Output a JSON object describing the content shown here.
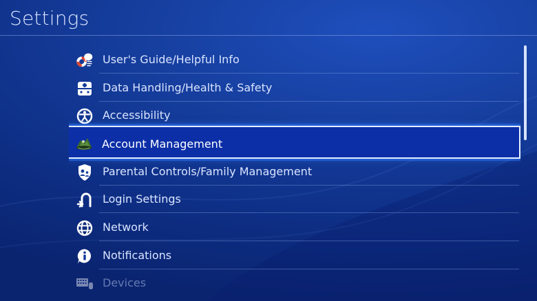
{
  "header": {
    "title": "Settings"
  },
  "menu": {
    "items": [
      {
        "label": "User's Guide/Helpful Info",
        "icon": "lifebuoy-chat-icon",
        "selected": false
      },
      {
        "label": "Data Handling/Health & Safety",
        "icon": "data-health-icon",
        "selected": false
      },
      {
        "label": "Accessibility",
        "icon": "accessibility-icon",
        "selected": false
      },
      {
        "label": "Account Management",
        "icon": "account-avatar-icon",
        "selected": true
      },
      {
        "label": "Parental Controls/Family Management",
        "icon": "parental-controls-icon",
        "selected": false
      },
      {
        "label": "Login Settings",
        "icon": "login-settings-icon",
        "selected": false
      },
      {
        "label": "Network",
        "icon": "globe-icon",
        "selected": false
      },
      {
        "label": "Notifications",
        "icon": "info-icon",
        "selected": false
      },
      {
        "label": "Devices",
        "icon": "keyboard-icon",
        "selected": false
      }
    ]
  },
  "colors": {
    "background": "#133a9a",
    "selected_fill": "#0c2fa8",
    "selected_border": "#e6eeff",
    "text": "#d9e4ff"
  }
}
